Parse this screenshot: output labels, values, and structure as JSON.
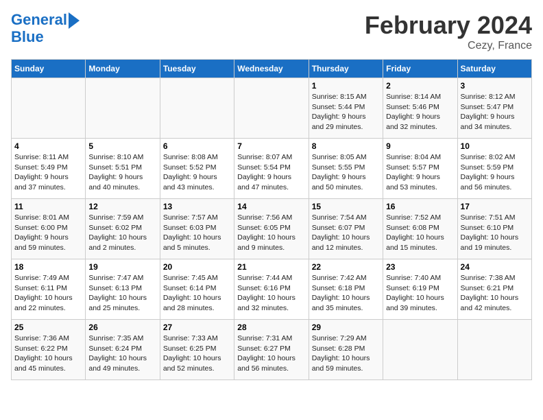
{
  "header": {
    "logo_line1": "General",
    "logo_line2": "Blue",
    "title": "February 2024",
    "subtitle": "Cezy, France"
  },
  "columns": [
    "Sunday",
    "Monday",
    "Tuesday",
    "Wednesday",
    "Thursday",
    "Friday",
    "Saturday"
  ],
  "weeks": [
    [
      {
        "day": "",
        "info": ""
      },
      {
        "day": "",
        "info": ""
      },
      {
        "day": "",
        "info": ""
      },
      {
        "day": "",
        "info": ""
      },
      {
        "day": "1",
        "info": "Sunrise: 8:15 AM\nSunset: 5:44 PM\nDaylight: 9 hours\nand 29 minutes."
      },
      {
        "day": "2",
        "info": "Sunrise: 8:14 AM\nSunset: 5:46 PM\nDaylight: 9 hours\nand 32 minutes."
      },
      {
        "day": "3",
        "info": "Sunrise: 8:12 AM\nSunset: 5:47 PM\nDaylight: 9 hours\nand 34 minutes."
      }
    ],
    [
      {
        "day": "4",
        "info": "Sunrise: 8:11 AM\nSunset: 5:49 PM\nDaylight: 9 hours\nand 37 minutes."
      },
      {
        "day": "5",
        "info": "Sunrise: 8:10 AM\nSunset: 5:51 PM\nDaylight: 9 hours\nand 40 minutes."
      },
      {
        "day": "6",
        "info": "Sunrise: 8:08 AM\nSunset: 5:52 PM\nDaylight: 9 hours\nand 43 minutes."
      },
      {
        "day": "7",
        "info": "Sunrise: 8:07 AM\nSunset: 5:54 PM\nDaylight: 9 hours\nand 47 minutes."
      },
      {
        "day": "8",
        "info": "Sunrise: 8:05 AM\nSunset: 5:55 PM\nDaylight: 9 hours\nand 50 minutes."
      },
      {
        "day": "9",
        "info": "Sunrise: 8:04 AM\nSunset: 5:57 PM\nDaylight: 9 hours\nand 53 minutes."
      },
      {
        "day": "10",
        "info": "Sunrise: 8:02 AM\nSunset: 5:59 PM\nDaylight: 9 hours\nand 56 minutes."
      }
    ],
    [
      {
        "day": "11",
        "info": "Sunrise: 8:01 AM\nSunset: 6:00 PM\nDaylight: 9 hours\nand 59 minutes."
      },
      {
        "day": "12",
        "info": "Sunrise: 7:59 AM\nSunset: 6:02 PM\nDaylight: 10 hours\nand 2 minutes."
      },
      {
        "day": "13",
        "info": "Sunrise: 7:57 AM\nSunset: 6:03 PM\nDaylight: 10 hours\nand 5 minutes."
      },
      {
        "day": "14",
        "info": "Sunrise: 7:56 AM\nSunset: 6:05 PM\nDaylight: 10 hours\nand 9 minutes."
      },
      {
        "day": "15",
        "info": "Sunrise: 7:54 AM\nSunset: 6:07 PM\nDaylight: 10 hours\nand 12 minutes."
      },
      {
        "day": "16",
        "info": "Sunrise: 7:52 AM\nSunset: 6:08 PM\nDaylight: 10 hours\nand 15 minutes."
      },
      {
        "day": "17",
        "info": "Sunrise: 7:51 AM\nSunset: 6:10 PM\nDaylight: 10 hours\nand 19 minutes."
      }
    ],
    [
      {
        "day": "18",
        "info": "Sunrise: 7:49 AM\nSunset: 6:11 PM\nDaylight: 10 hours\nand 22 minutes."
      },
      {
        "day": "19",
        "info": "Sunrise: 7:47 AM\nSunset: 6:13 PM\nDaylight: 10 hours\nand 25 minutes."
      },
      {
        "day": "20",
        "info": "Sunrise: 7:45 AM\nSunset: 6:14 PM\nDaylight: 10 hours\nand 28 minutes."
      },
      {
        "day": "21",
        "info": "Sunrise: 7:44 AM\nSunset: 6:16 PM\nDaylight: 10 hours\nand 32 minutes."
      },
      {
        "day": "22",
        "info": "Sunrise: 7:42 AM\nSunset: 6:18 PM\nDaylight: 10 hours\nand 35 minutes."
      },
      {
        "day": "23",
        "info": "Sunrise: 7:40 AM\nSunset: 6:19 PM\nDaylight: 10 hours\nand 39 minutes."
      },
      {
        "day": "24",
        "info": "Sunrise: 7:38 AM\nSunset: 6:21 PM\nDaylight: 10 hours\nand 42 minutes."
      }
    ],
    [
      {
        "day": "25",
        "info": "Sunrise: 7:36 AM\nSunset: 6:22 PM\nDaylight: 10 hours\nand 45 minutes."
      },
      {
        "day": "26",
        "info": "Sunrise: 7:35 AM\nSunset: 6:24 PM\nDaylight: 10 hours\nand 49 minutes."
      },
      {
        "day": "27",
        "info": "Sunrise: 7:33 AM\nSunset: 6:25 PM\nDaylight: 10 hours\nand 52 minutes."
      },
      {
        "day": "28",
        "info": "Sunrise: 7:31 AM\nSunset: 6:27 PM\nDaylight: 10 hours\nand 56 minutes."
      },
      {
        "day": "29",
        "info": "Sunrise: 7:29 AM\nSunset: 6:28 PM\nDaylight: 10 hours\nand 59 minutes."
      },
      {
        "day": "",
        "info": ""
      },
      {
        "day": "",
        "info": ""
      }
    ]
  ]
}
